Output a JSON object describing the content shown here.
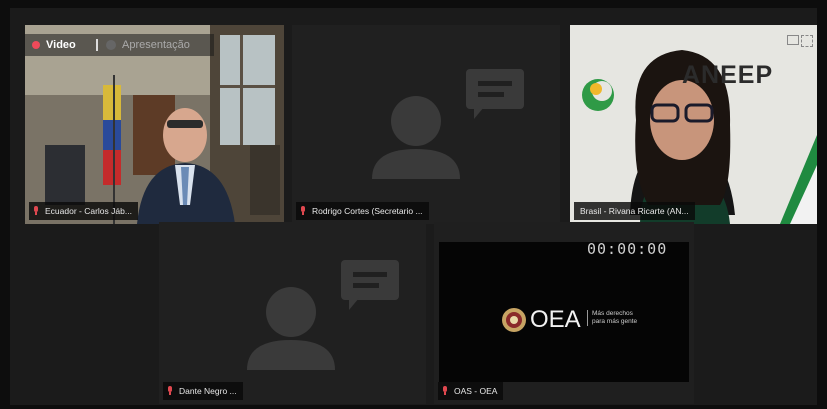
{
  "view_toggle": {
    "video_label": "Video",
    "presentation_label": "Apresentação"
  },
  "participants": [
    {
      "name": "Ecuador - Carlos Jáb...",
      "video": true
    },
    {
      "name": "Rodrigo Cortes (Secretario ...",
      "video": false
    },
    {
      "name": "Brasil - Rivana Ricarte (AN...",
      "video": true
    },
    {
      "name": "Dante Negro ...",
      "video": false
    },
    {
      "name": "OAS - OEA",
      "video": true
    }
  ],
  "oas_tile": {
    "timer": "00:00:00",
    "logo_text": "OEA",
    "tagline": "Más derechos para más gente"
  },
  "brasil_tile": {
    "logo_text": "ANEEP"
  },
  "colors": {
    "mic_muted": "#e0484f",
    "avatar": "#3a3a3a",
    "rec_dot": "#f04a5a"
  }
}
